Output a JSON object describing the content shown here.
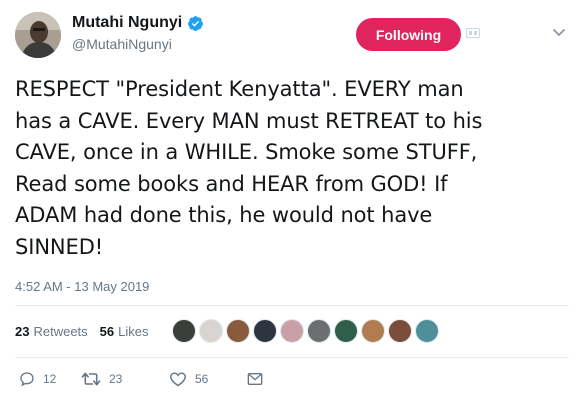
{
  "header": {
    "display_name": "Mutahi Ngunyi",
    "handle": "@MutahiNgunyi",
    "verified": true,
    "follow_label": "Following"
  },
  "tweet": {
    "text": "RESPECT \"President Kenyatta\". EVERY man\nhas a CAVE. Every MAN must RETREAT to his\nCAVE, once in a WHILE. Smoke some STUFF,\nRead some books and HEAR from GOD! If\nADAM had done this, he would not have\nSINNED!",
    "timestamp": "4:52 AM - 13 May 2019"
  },
  "stats": {
    "retweets_count": "23",
    "retweets_label": "Retweets",
    "likes_count": "56",
    "likes_label": "Likes"
  },
  "likers": [
    {
      "color": "#3a3f3a"
    },
    {
      "color": "#d9d4cf"
    },
    {
      "color": "#8a5a3c"
    },
    {
      "color": "#2d3540"
    },
    {
      "color": "#c9a0a8"
    },
    {
      "color": "#6b6f70"
    },
    {
      "color": "#2f5f4a"
    },
    {
      "color": "#b07c50"
    },
    {
      "color": "#7a4e3a"
    },
    {
      "color": "#4f8f9a"
    }
  ],
  "actions": {
    "replies": "12",
    "retweets": "23",
    "likes": "56"
  },
  "colors": {
    "follow_bg": "#e0245e",
    "verified": "#1da1f2",
    "muted": "#657786"
  }
}
